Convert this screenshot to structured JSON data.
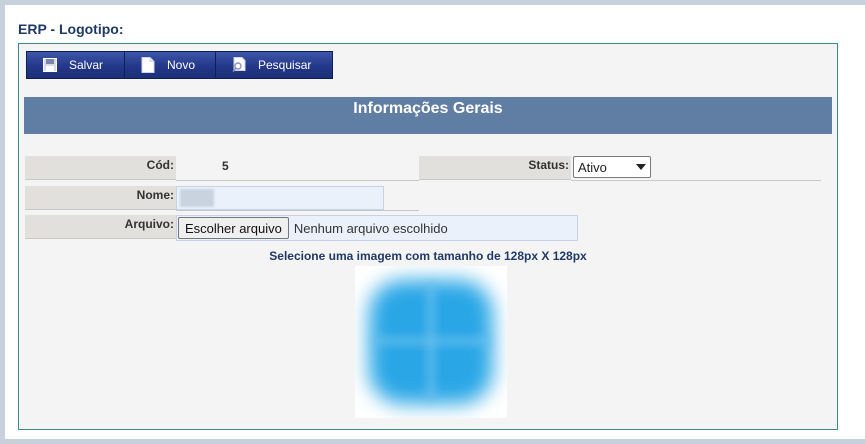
{
  "page": {
    "title": "ERP - Logotipo:"
  },
  "toolbar": {
    "buttons": [
      {
        "label": "Salvar",
        "icon": "floppy-disk-icon"
      },
      {
        "label": "Novo",
        "icon": "new-document-icon"
      },
      {
        "label": "Pesquisar",
        "icon": "search-document-icon"
      }
    ]
  },
  "section": {
    "title": "Informações Gerais"
  },
  "form": {
    "cod": {
      "label": "Cód:",
      "value": "5"
    },
    "status": {
      "label": "Status:",
      "selected": "Ativo"
    },
    "nome": {
      "label": "Nome:",
      "value": ""
    },
    "arquivo": {
      "label": "Arquivo:",
      "button": "Escolher arquivo",
      "status": "Nenhum arquivo escolhido"
    },
    "hint": "Selecione uma imagem com tamanho de 128px X 128px"
  },
  "logo": {
    "icon": "company-logo-image"
  },
  "colors": {
    "toolbar": "#24378a",
    "section_bar": "#607ea3",
    "title": "#1f3a66",
    "panel_border": "#3a8a8a",
    "logo": "#28a6e6"
  }
}
